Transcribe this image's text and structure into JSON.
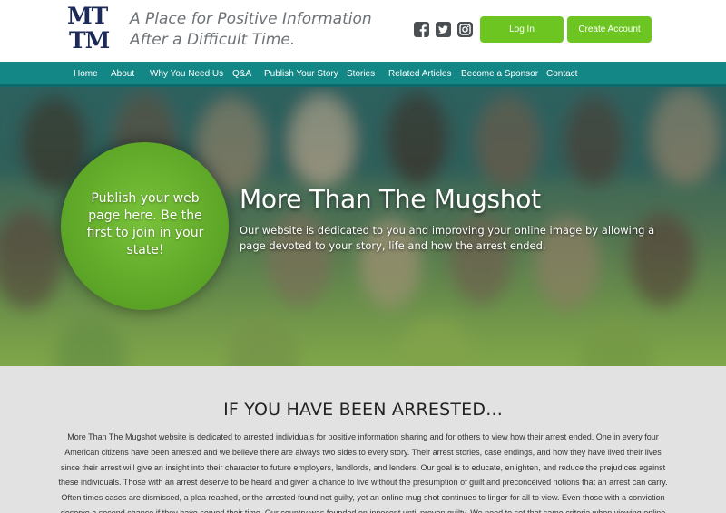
{
  "brand": {
    "logo_line1": "MT",
    "logo_line2": "TM",
    "tagline_line1": "A Place for Positive Information",
    "tagline_line2": "After a Difficult Time."
  },
  "social": [
    "facebook-icon",
    "twitter-icon",
    "instagram-icon"
  ],
  "auth": {
    "login_label": "Log In",
    "create_label": "Create Account"
  },
  "nav": {
    "items": [
      "Home",
      "About",
      "Why You Need Us",
      "Q&A",
      "Publish Your Story",
      "Stories",
      "Related Articles",
      "Become a Sponsor",
      "Contact"
    ]
  },
  "hero": {
    "circle_text": "Publish your web page here. Be the first to join in your state!",
    "title": "More Than The Mugshot",
    "subtitle": "Our website is dedicated to you and improving your online image by allowing a page devoted to your story, life and how the arrest ended."
  },
  "section": {
    "title": "IF YOU HAVE BEEN ARRESTED...",
    "body": "More Than The Mugshot website is dedicated to arrested individuals for positive information sharing and for others to view how their arrest ended. One in every four American citizens have been arrested and we believe there are always two sides to every story. Their arrest stories, case endings, and how they have lived their lives since their arrest will give an insight into their character to future employers, landlords, and lenders. Our goal is to educate, enlighten, and reduce the prejudices against these individuals. Those with an arrest deserve to be heard and given a chance to live without the presumption of guilt and preconceived notions that an arrest can carry. Often times cases are dismissed, a plea reached, or the arrested found not guilty, yet an online mug shot continues to linger for all to view. Even those with a conviction deserve a second chance if they have served their time. Our country was founded on innocent until proven guilty. We need to set that same criteria when viewing online mug shots. Innocent or guilty,"
  },
  "colors": {
    "accent_green": "#6cc520",
    "nav_teal": "#138686",
    "logo_navy": "#1c2a5a",
    "content_bg": "#e2e2e2"
  }
}
